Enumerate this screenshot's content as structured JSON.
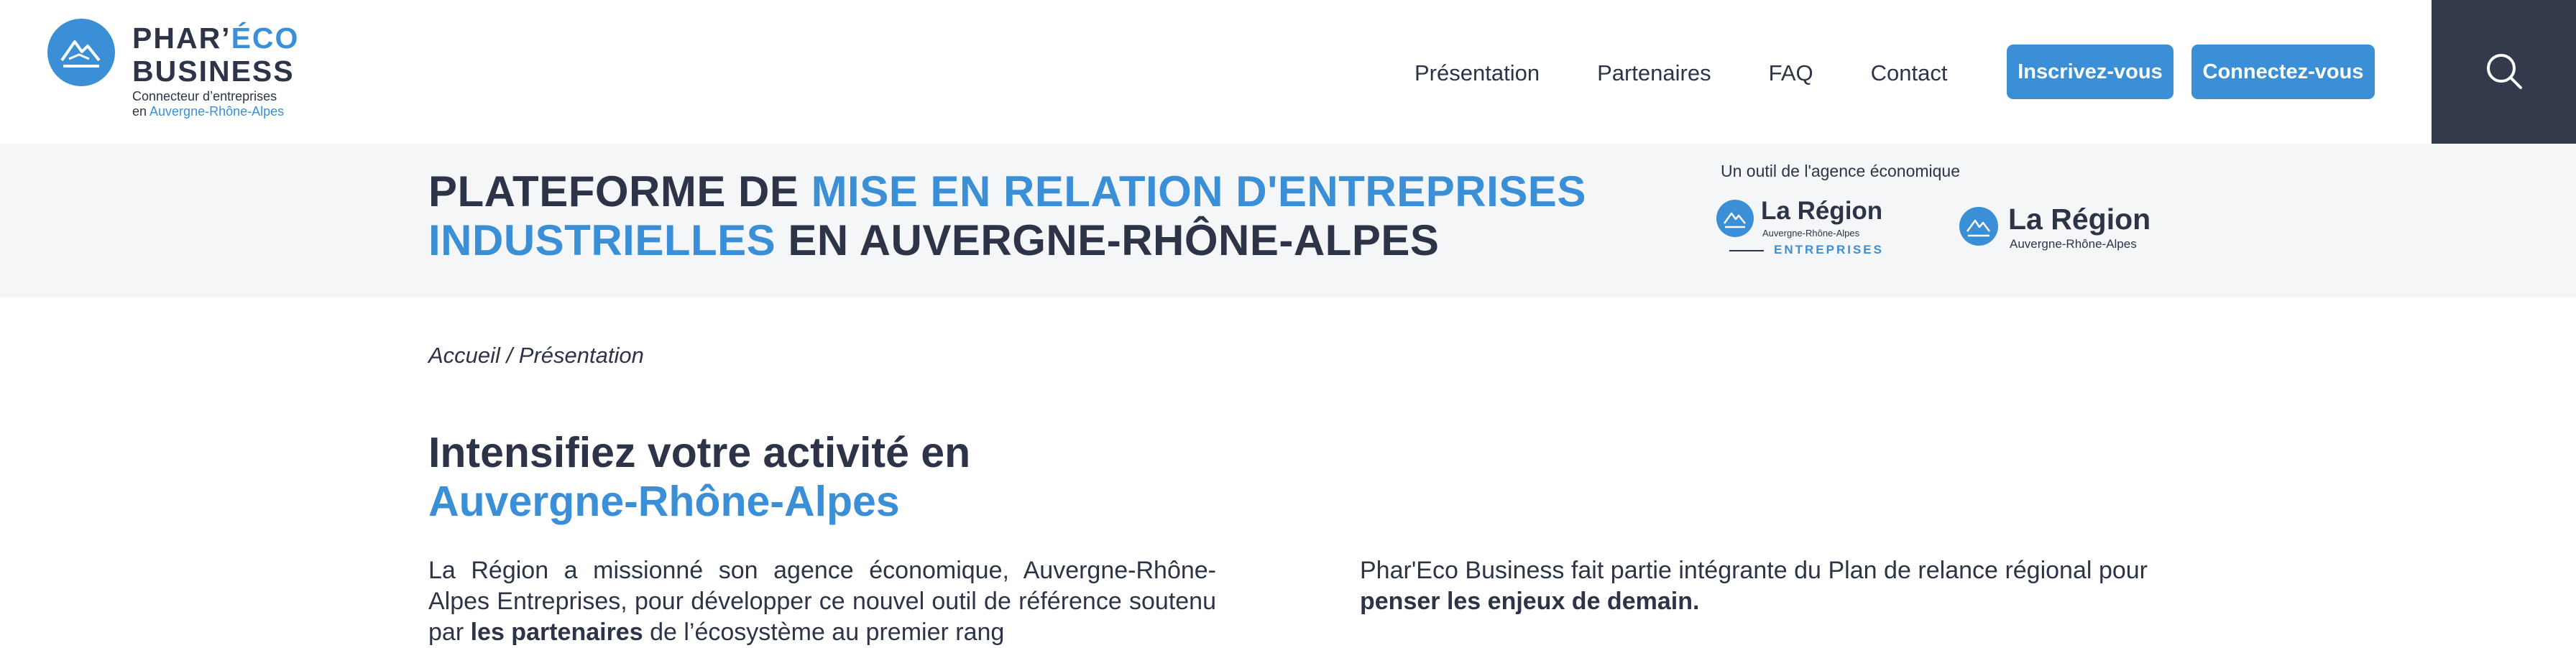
{
  "header": {
    "logo": {
      "name_part1": "PHAR’",
      "name_part2": "ÉCO",
      "name_line2": "BUSINESS",
      "tagline_line1": "Connecteur d’entreprises",
      "tagline_prefix": "en ",
      "tagline_region": "Auvergne-Rhône-Alpes"
    },
    "nav": [
      {
        "label": "Présentation"
      },
      {
        "label": "Partenaires"
      },
      {
        "label": "FAQ"
      },
      {
        "label": "Contact"
      }
    ],
    "register_label": "Inscrivez-vous",
    "login_label": "Connectez-vous",
    "search_icon": "search-icon"
  },
  "banner": {
    "title_part1": "PLATEFORME DE ",
    "title_highlight": "MISE EN RELATION D'ENTREPRISES INDUSTRIELLES",
    "title_part2": " EN AUVERGNE-RHÔNE-ALPES",
    "outil_text": "Un outil de l'agence économique",
    "logo1": {
      "name": "La Région",
      "sub": "Auvergne-Rhône-Alpes",
      "label": "ENTREPRISES"
    },
    "logo2": {
      "name": "La Région",
      "sub": "Auvergne-Rhône-Alpes"
    }
  },
  "breadcrumb": {
    "home": "Accueil",
    "separator": " / ",
    "current": "Présentation"
  },
  "main": {
    "heading_line1": "Intensifiez votre activité en",
    "heading_line2": "Auvergne-Rhône-Alpes",
    "para_left_1": "La Région a missionné son agence économique, Auvergne-Rhône-Alpes Entreprises, pour développer ce nouvel outil de référence soutenu par ",
    "para_left_bold": "les partenaires",
    "para_left_2": " de l’écosystème au premier rang",
    "para_right_1": "Phar'Eco Business fait partie intégrante du Plan de relance régional pour ",
    "para_right_bold": "penser les enjeux de demain."
  },
  "colors": {
    "accent": "#3a8fd6",
    "text": "#2d3447",
    "search_bg": "#333a4b",
    "banner_bg": "#f4f6f8"
  }
}
